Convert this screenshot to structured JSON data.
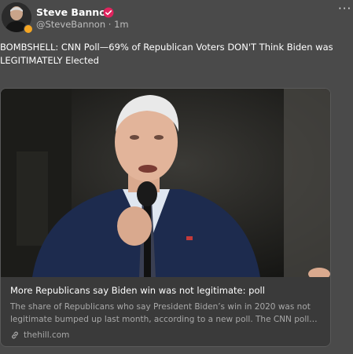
{
  "author": {
    "name": "Steve Bannon",
    "handle": "@SteveBannon",
    "separator": "·",
    "time": "1m",
    "verified_color": "#e0245e"
  },
  "post": {
    "text": "BOMBSHELL: CNN Poll—69% of Republican Voters DON'T Think Biden was LEGITIMATELY Elected"
  },
  "card": {
    "title": "More Republicans say Biden win was not legitimate: poll",
    "description": "The share of Republicans who say President Biden’s win in 2020 was not legitimate bumped up last month, according to a new poll. The CNN poll…",
    "domain": "thehill.com"
  },
  "menu": {
    "label": "···"
  }
}
